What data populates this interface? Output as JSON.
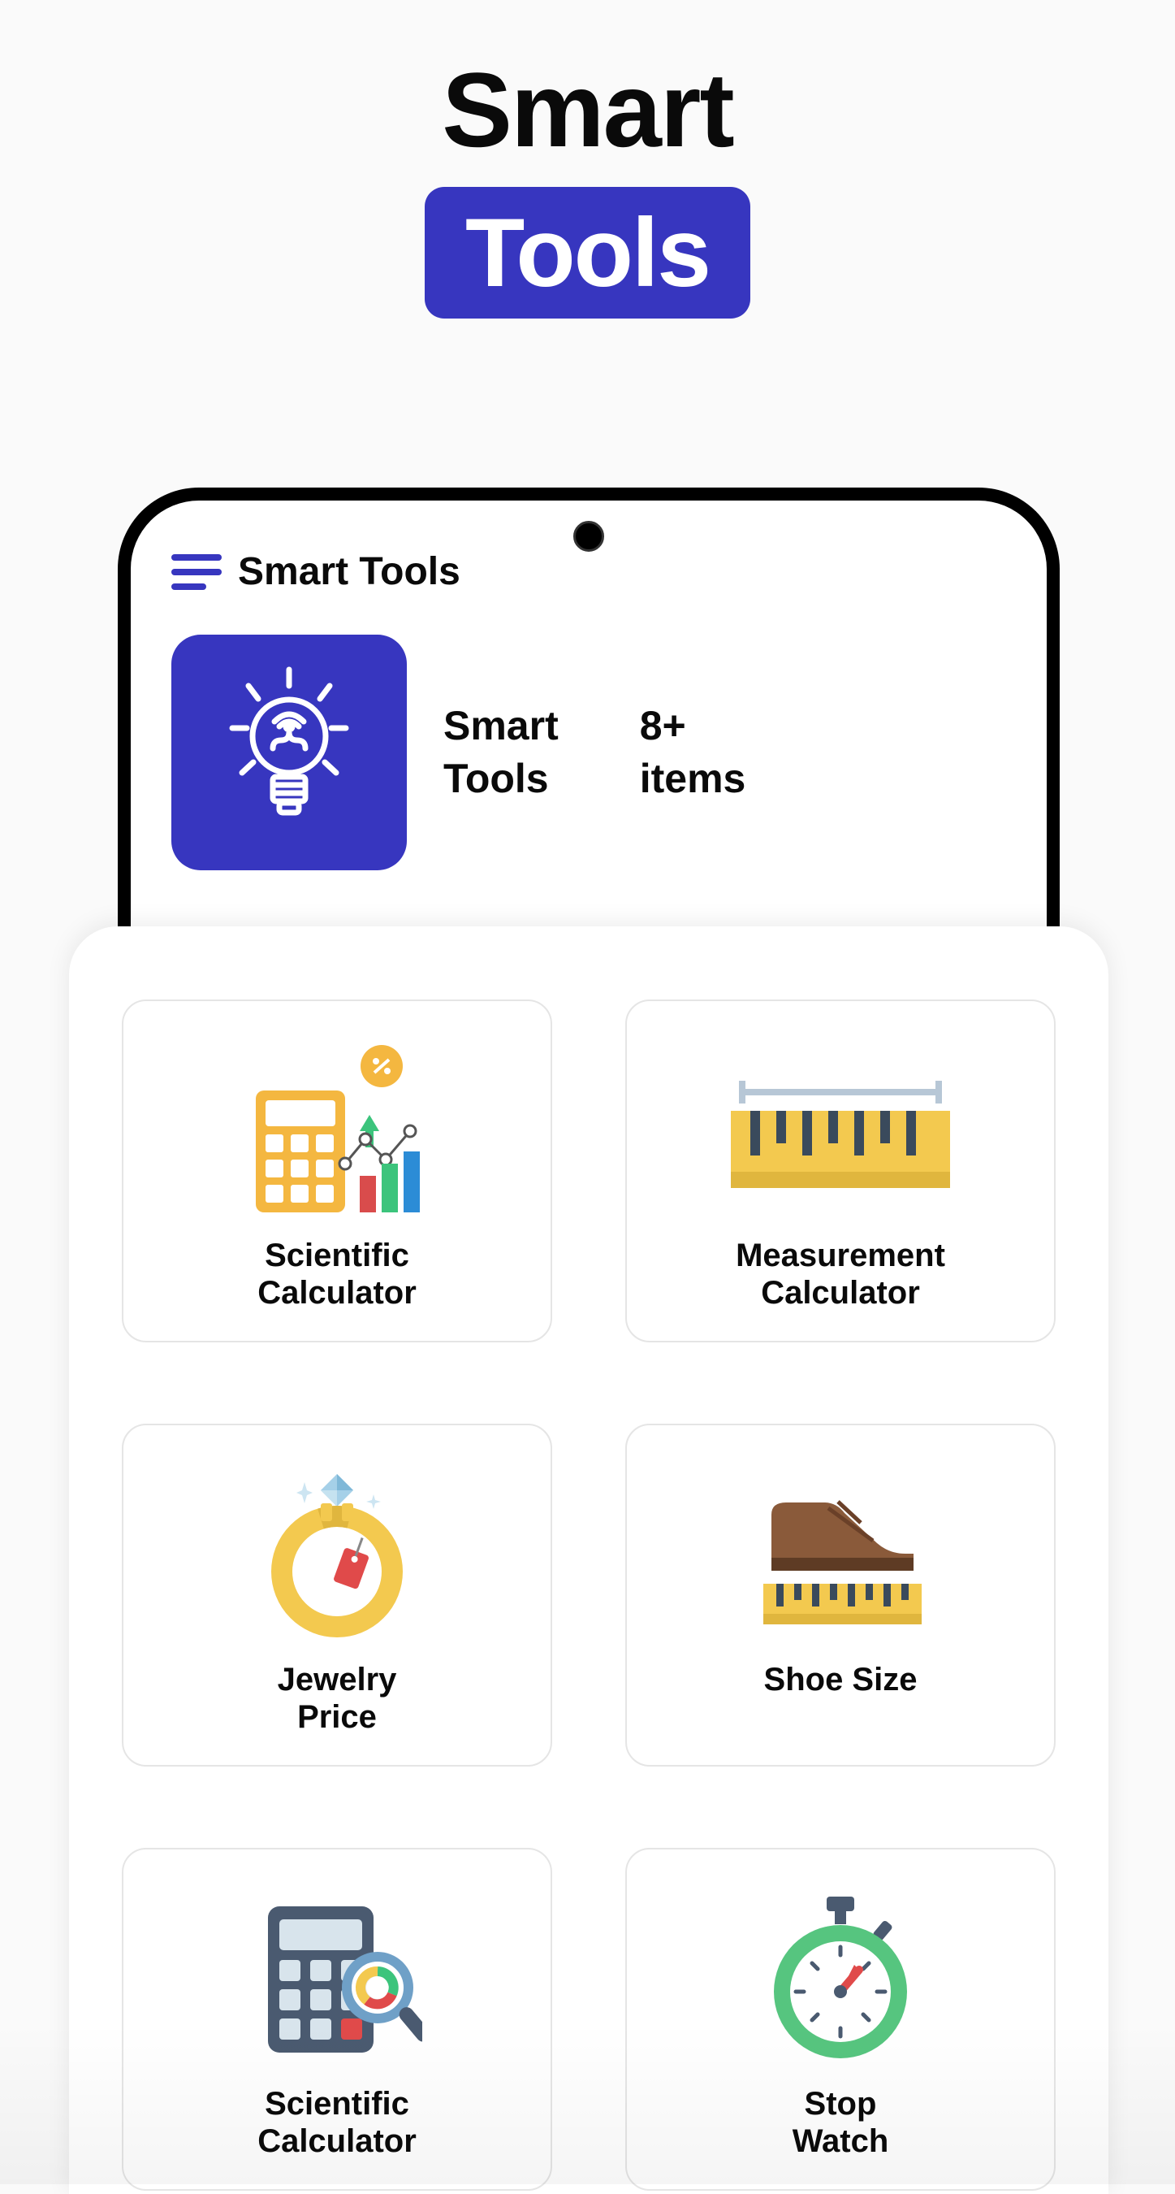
{
  "header": {
    "title_line1": "Smart",
    "title_line2": "Tools"
  },
  "phone": {
    "app_title": "Smart Tools",
    "info_label1": "Smart\nTools",
    "info_label2": "8+\nitems"
  },
  "tools": [
    {
      "id": "scientific-calculator",
      "label": "Scientific\nCalculator",
      "icon": "scientific-calculator-icon"
    },
    {
      "id": "measurement-calculator",
      "label": "Measurement\nCalculator",
      "icon": "measurement-calculator-icon"
    },
    {
      "id": "jewelry-price",
      "label": "Jewelry\nPrice",
      "icon": "jewelry-price-icon"
    },
    {
      "id": "shoe-size",
      "label": "Shoe Size",
      "icon": "shoe-size-icon"
    },
    {
      "id": "scientific-calculator-2",
      "label": "Scientific\nCalculator",
      "icon": "calculator-search-icon"
    },
    {
      "id": "stop-watch",
      "label": "Stop\nWatch",
      "icon": "stop-watch-icon"
    }
  ],
  "colors": {
    "accent": "#3736bf"
  }
}
